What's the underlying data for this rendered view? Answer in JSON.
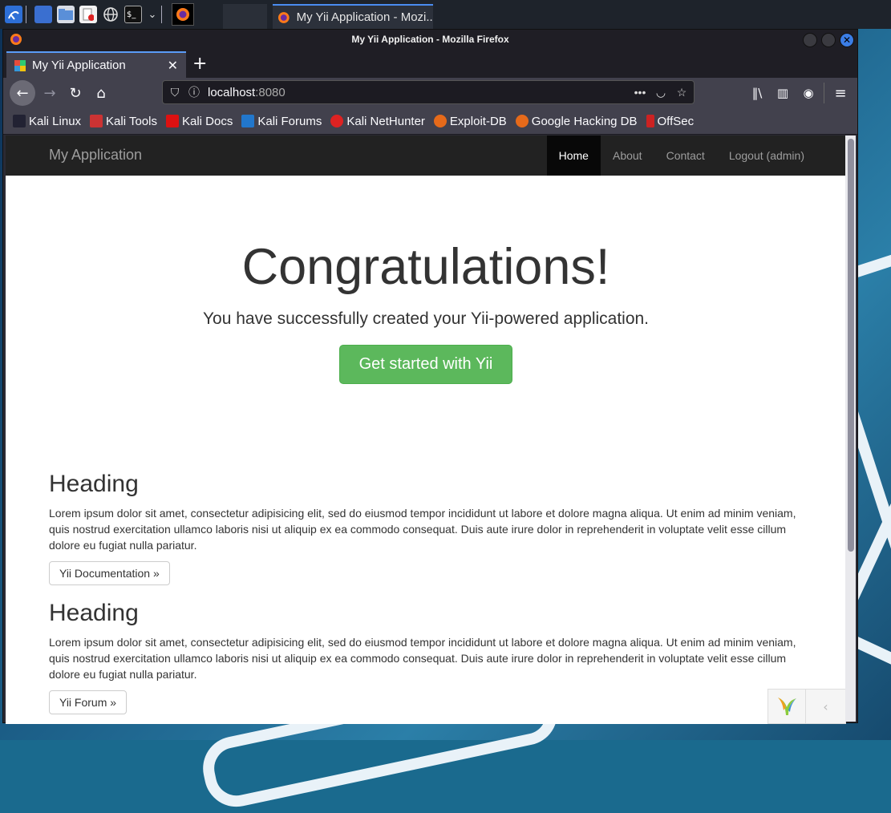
{
  "browser": {
    "window_title": "My Yii Application - Mozilla Firefox",
    "taskbar_title": "My Yii Application - Mozi...",
    "tab_title": "My Yii Application",
    "url_host": "localhost",
    "url_port": ":8080",
    "bookmarks": [
      {
        "label": "Kali Linux",
        "color": "#223"
      },
      {
        "label": "Kali Tools",
        "color": "#c33"
      },
      {
        "label": "Kali Docs",
        "color": "#d11"
      },
      {
        "label": "Kali Forums",
        "color": "#27c"
      },
      {
        "label": "Kali NetHunter",
        "color": "#d22"
      },
      {
        "label": "Exploit-DB",
        "color": "#e66a1a"
      },
      {
        "label": "Google Hacking DB",
        "color": "#e66a1a"
      },
      {
        "label": "OffSec",
        "color": "#c22"
      }
    ]
  },
  "app": {
    "brand": "My Application",
    "menu": [
      "Home",
      "About",
      "Contact",
      "Logout (admin)"
    ],
    "active_menu": "Home"
  },
  "jumbotron": {
    "title": "Congratulations!",
    "lead": "You have successfully created your Yii-powered application.",
    "button": "Get started with Yii"
  },
  "sections": [
    {
      "heading": "Heading",
      "text": "Lorem ipsum dolor sit amet, consectetur adipisicing elit, sed do eiusmod tempor incididunt ut labore et dolore magna aliqua. Ut enim ad minim veniam, quis nostrud exercitation ullamco laboris nisi ut aliquip ex ea commodo consequat. Duis aute irure dolor in reprehenderit in voluptate velit esse cillum dolore eu fugiat nulla pariatur.",
      "button": "Yii Documentation »"
    },
    {
      "heading": "Heading",
      "text": "Lorem ipsum dolor sit amet, consectetur adipisicing elit, sed do eiusmod tempor incididunt ut labore et dolore magna aliqua. Ut enim ad minim veniam, quis nostrud exercitation ullamco laboris nisi ut aliquip ex ea commodo consequat. Duis aute irure dolor in reprehenderit in voluptate velit esse cillum dolore eu fugiat nulla pariatur.",
      "button": "Yii Forum »"
    }
  ]
}
